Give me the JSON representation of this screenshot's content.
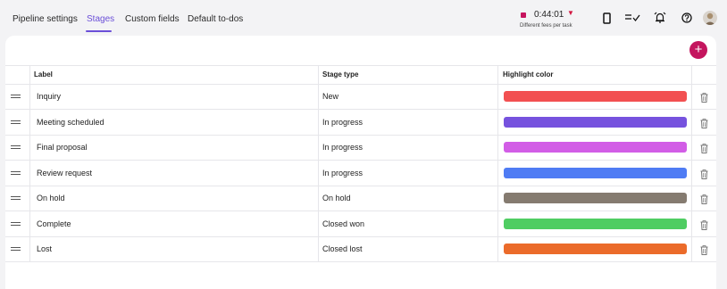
{
  "tabs": [
    {
      "label": "Pipeline settings",
      "active": false
    },
    {
      "label": "Stages",
      "active": true
    },
    {
      "label": "Custom fields",
      "active": false
    },
    {
      "label": "Default to-dos",
      "active": false
    }
  ],
  "timer": {
    "time": "0:44:01",
    "caret": "▼",
    "subtitle": "Different fees per task",
    "dot_color": "#c6145e"
  },
  "toolbar_icons": [
    "mobile-icon",
    "task-list-icon",
    "alarm-icon",
    "help-icon",
    "avatar"
  ],
  "add_button": {
    "label": "+",
    "color": "#c4155e"
  },
  "table": {
    "headers": {
      "label": "Label",
      "stage_type": "Stage type",
      "highlight": "Highlight color"
    },
    "rows": [
      {
        "label": "Inquiry",
        "stage_type": "New",
        "color": "#f25051"
      },
      {
        "label": "Meeting scheduled",
        "stage_type": "In progress",
        "color": "#7652de"
      },
      {
        "label": "Final proposal",
        "stage_type": "In progress",
        "color": "#d25de6"
      },
      {
        "label": "Review request",
        "stage_type": "In progress",
        "color": "#4f7cf4"
      },
      {
        "label": "On hold",
        "stage_type": "On hold",
        "color": "#857b70"
      },
      {
        "label": "Complete",
        "stage_type": "Closed won",
        "color": "#4fcd62"
      },
      {
        "label": "Lost",
        "stage_type": "Closed lost",
        "color": "#eb6b2a"
      }
    ]
  },
  "accent_color": "#6b4fd8"
}
